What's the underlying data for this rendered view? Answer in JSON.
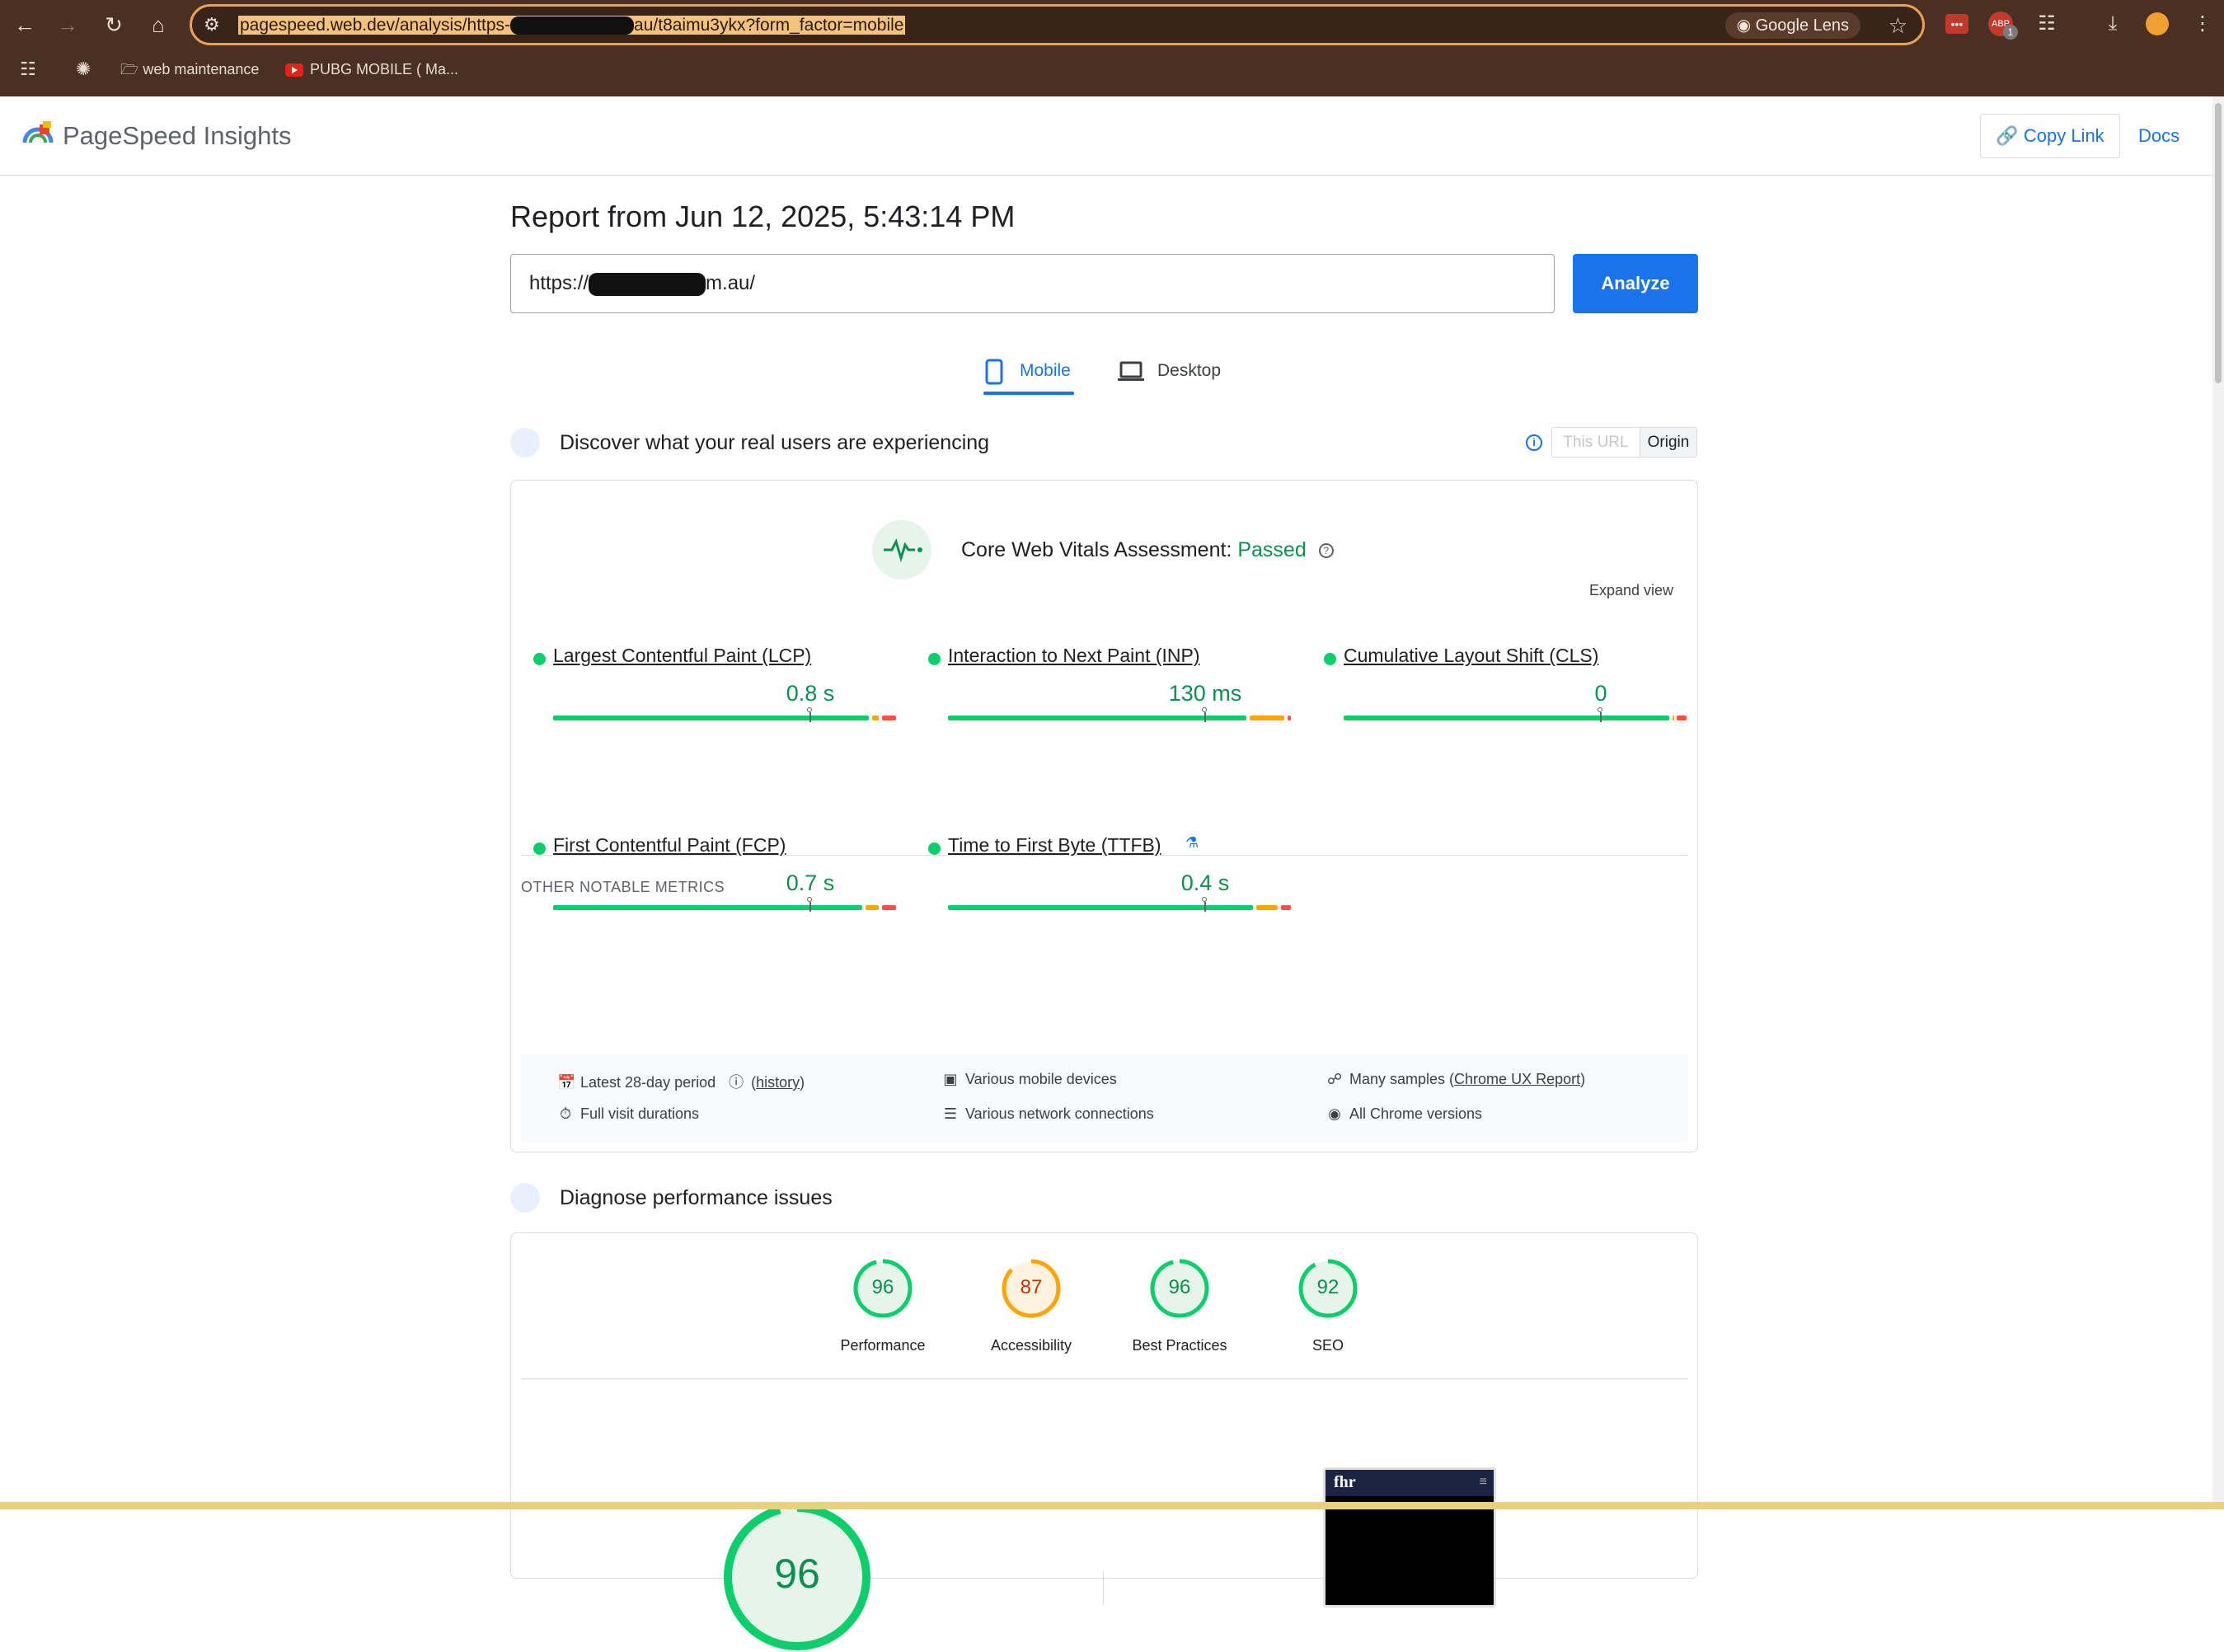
{
  "browser": {
    "url_prefix": "pagespeed.web.dev/analysis/https-",
    "url_suffix": "au/t8aimu3ykx?form_factor=mobile",
    "lens_label": "Google Lens",
    "bookmarks": [
      "web maintenance",
      "PUBG MOBILE ( Ma..."
    ],
    "extension_badge": "1"
  },
  "psi": {
    "app_title": "PageSpeed Insights",
    "copy_link_label": "Copy Link",
    "docs_label": "Docs",
    "report_title": "Report from Jun 12, 2025, 5:43:14 PM",
    "url_input_prefix": "https://",
    "url_input_suffix": "m.au/",
    "analyze_label": "Analyze",
    "tabs": [
      "Mobile",
      "Desktop"
    ]
  },
  "field": {
    "section_title": "Discover what your real users are experiencing",
    "toggle": [
      "This URL",
      "Origin"
    ],
    "cwv_label": "Core Web Vitals Assessment:",
    "cwv_status": "Passed",
    "expand_label": "Expand view",
    "other_label": "OTHER NOTABLE METRICS",
    "metrics": [
      {
        "name": "Largest Contentful Paint (LCP)",
        "value": "0.8 s",
        "marker": 0.75,
        "good": 0.93,
        "ni": 0.03
      },
      {
        "name": "Interaction to Next Paint (INP)",
        "value": "130 ms",
        "marker": 0.75,
        "good": 0.88,
        "ni": 0.11
      },
      {
        "name": "Cumulative Layout Shift (CLS)",
        "value": "0",
        "marker": 0.75,
        "good": 0.96,
        "ni": 0.01
      },
      {
        "name": "First Contentful Paint (FCP)",
        "value": "0.7 s",
        "marker": 0.75,
        "good": 0.91,
        "ni": 0.05
      },
      {
        "name": "Time to First Byte (TTFB)",
        "value": "0.4 s",
        "marker": 0.75,
        "good": 0.9,
        "ni": 0.07
      }
    ],
    "footer": {
      "period": "Latest 28-day period",
      "history": "history",
      "devices": "Various mobile devices",
      "samples_prefix": "Many samples (",
      "samples_link": "Chrome UX Report",
      "samples_suffix": ")",
      "durations": "Full visit durations",
      "network": "Various network connections",
      "chrome": "All Chrome versions"
    }
  },
  "lab": {
    "section_title": "Diagnose performance issues",
    "scores": [
      {
        "value": 96,
        "label": "Performance"
      },
      {
        "value": 87,
        "label": "Accessibility"
      },
      {
        "value": 96,
        "label": "Best Practices"
      },
      {
        "value": 92,
        "label": "SEO"
      }
    ],
    "performance_score": "96",
    "screenshot_logo": "fhr",
    "colors": {
      "pass": "#0cce6b",
      "pass_text": "#0d904f",
      "average": "#ffa400",
      "average_text": "#c33300",
      "poor": "#ff4e42"
    }
  }
}
